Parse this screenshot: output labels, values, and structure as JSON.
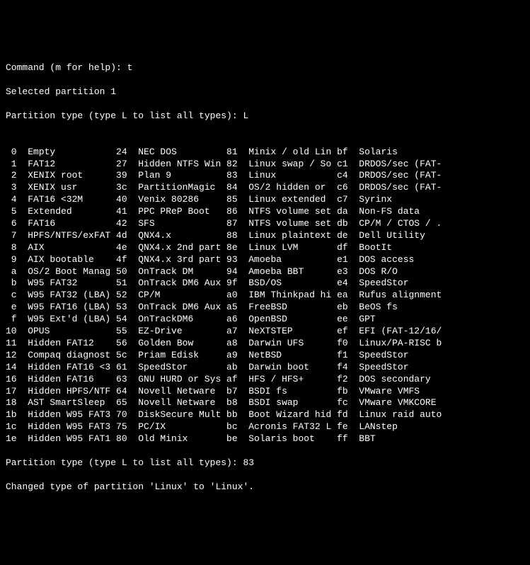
{
  "prompt1": "Command (m for help): ",
  "input1": "t",
  "line_selected": "Selected partition 1",
  "prompt2": "Partition type (type L to list all types): ",
  "input2": "L",
  "blank": "",
  "types": [
    {
      "c1": " 0",
      "n1": "Empty",
      "c2": "24",
      "n2": "NEC DOS",
      "c3": "81",
      "n3": "Minix / old Lin",
      "c4": "bf",
      "n4": "Solaris"
    },
    {
      "c1": " 1",
      "n1": "FAT12",
      "c2": "27",
      "n2": "Hidden NTFS Win",
      "c3": "82",
      "n3": "Linux swap / So",
      "c4": "c1",
      "n4": "DRDOS/sec (FAT-"
    },
    {
      "c1": " 2",
      "n1": "XENIX root",
      "c2": "39",
      "n2": "Plan 9",
      "c3": "83",
      "n3": "Linux",
      "c4": "c4",
      "n4": "DRDOS/sec (FAT-"
    },
    {
      "c1": " 3",
      "n1": "XENIX usr",
      "c2": "3c",
      "n2": "PartitionMagic",
      "c3": "84",
      "n3": "OS/2 hidden or",
      "c4": "c6",
      "n4": "DRDOS/sec (FAT-"
    },
    {
      "c1": " 4",
      "n1": "FAT16 <32M",
      "c2": "40",
      "n2": "Venix 80286",
      "c3": "85",
      "n3": "Linux extended",
      "c4": "c7",
      "n4": "Syrinx"
    },
    {
      "c1": " 5",
      "n1": "Extended",
      "c2": "41",
      "n2": "PPC PReP Boot",
      "c3": "86",
      "n3": "NTFS volume set",
      "c4": "da",
      "n4": "Non-FS data"
    },
    {
      "c1": " 6",
      "n1": "FAT16",
      "c2": "42",
      "n2": "SFS",
      "c3": "87",
      "n3": "NTFS volume set",
      "c4": "db",
      "n4": "CP/M / CTOS / ."
    },
    {
      "c1": " 7",
      "n1": "HPFS/NTFS/exFAT",
      "c2": "4d",
      "n2": "QNX4.x",
      "c3": "88",
      "n3": "Linux plaintext",
      "c4": "de",
      "n4": "Dell Utility"
    },
    {
      "c1": " 8",
      "n1": "AIX",
      "c2": "4e",
      "n2": "QNX4.x 2nd part",
      "c3": "8e",
      "n3": "Linux LVM",
      "c4": "df",
      "n4": "BootIt"
    },
    {
      "c1": " 9",
      "n1": "AIX bootable",
      "c2": "4f",
      "n2": "QNX4.x 3rd part",
      "c3": "93",
      "n3": "Amoeba",
      "c4": "e1",
      "n4": "DOS access"
    },
    {
      "c1": " a",
      "n1": "OS/2 Boot Manag",
      "c2": "50",
      "n2": "OnTrack DM",
      "c3": "94",
      "n3": "Amoeba BBT",
      "c4": "e3",
      "n4": "DOS R/O"
    },
    {
      "c1": " b",
      "n1": "W95 FAT32",
      "c2": "51",
      "n2": "OnTrack DM6 Aux",
      "c3": "9f",
      "n3": "BSD/OS",
      "c4": "e4",
      "n4": "SpeedStor"
    },
    {
      "c1": " c",
      "n1": "W95 FAT32 (LBA)",
      "c2": "52",
      "n2": "CP/M",
      "c3": "a0",
      "n3": "IBM Thinkpad hi",
      "c4": "ea",
      "n4": "Rufus alignment"
    },
    {
      "c1": " e",
      "n1": "W95 FAT16 (LBA)",
      "c2": "53",
      "n2": "OnTrack DM6 Aux",
      "c3": "a5",
      "n3": "FreeBSD",
      "c4": "eb",
      "n4": "BeOS fs"
    },
    {
      "c1": " f",
      "n1": "W95 Ext'd (LBA)",
      "c2": "54",
      "n2": "OnTrackDM6",
      "c3": "a6",
      "n3": "OpenBSD",
      "c4": "ee",
      "n4": "GPT"
    },
    {
      "c1": "10",
      "n1": "OPUS",
      "c2": "55",
      "n2": "EZ-Drive",
      "c3": "a7",
      "n3": "NeXTSTEP",
      "c4": "ef",
      "n4": "EFI (FAT-12/16/"
    },
    {
      "c1": "11",
      "n1": "Hidden FAT12",
      "c2": "56",
      "n2": "Golden Bow",
      "c3": "a8",
      "n3": "Darwin UFS",
      "c4": "f0",
      "n4": "Linux/PA-RISC b"
    },
    {
      "c1": "12",
      "n1": "Compaq diagnost",
      "c2": "5c",
      "n2": "Priam Edisk",
      "c3": "a9",
      "n3": "NetBSD",
      "c4": "f1",
      "n4": "SpeedStor"
    },
    {
      "c1": "14",
      "n1": "Hidden FAT16 <3",
      "c2": "61",
      "n2": "SpeedStor",
      "c3": "ab",
      "n3": "Darwin boot",
      "c4": "f4",
      "n4": "SpeedStor"
    },
    {
      "c1": "16",
      "n1": "Hidden FAT16",
      "c2": "63",
      "n2": "GNU HURD or Sys",
      "c3": "af",
      "n3": "HFS / HFS+",
      "c4": "f2",
      "n4": "DOS secondary"
    },
    {
      "c1": "17",
      "n1": "Hidden HPFS/NTF",
      "c2": "64",
      "n2": "Novell Netware",
      "c3": "b7",
      "n3": "BSDI fs",
      "c4": "fb",
      "n4": "VMware VMFS"
    },
    {
      "c1": "18",
      "n1": "AST SmartSleep",
      "c2": "65",
      "n2": "Novell Netware",
      "c3": "b8",
      "n3": "BSDI swap",
      "c4": "fc",
      "n4": "VMware VMKCORE"
    },
    {
      "c1": "1b",
      "n1": "Hidden W95 FAT3",
      "c2": "70",
      "n2": "DiskSecure Mult",
      "c3": "bb",
      "n3": "Boot Wizard hid",
      "c4": "fd",
      "n4": "Linux raid auto"
    },
    {
      "c1": "1c",
      "n1": "Hidden W95 FAT3",
      "c2": "75",
      "n2": "PC/IX",
      "c3": "bc",
      "n3": "Acronis FAT32 L",
      "c4": "fe",
      "n4": "LANstep"
    },
    {
      "c1": "1e",
      "n1": "Hidden W95 FAT1",
      "c2": "80",
      "n2": "Old Minix",
      "c3": "be",
      "n3": "Solaris boot",
      "c4": "ff",
      "n4": "BBT"
    }
  ],
  "prompt3": "Partition type (type L to list all types): ",
  "input3": "83",
  "result": "Changed type of partition 'Linux' to 'Linux'."
}
